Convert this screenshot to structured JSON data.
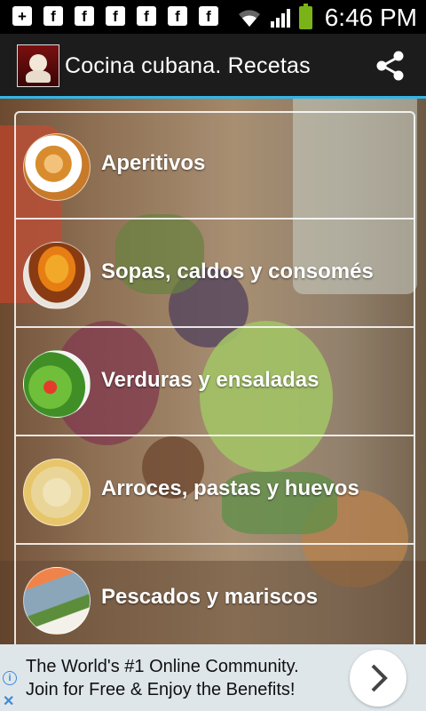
{
  "status_bar": {
    "time": "6:46 PM",
    "notification_icons": [
      "plus-box-icon",
      "facebook-icon",
      "facebook-icon",
      "facebook-icon",
      "facebook-icon",
      "facebook-icon",
      "facebook-icon"
    ],
    "notification_glyphs": [
      "+",
      "f",
      "f",
      "f",
      "f",
      "f",
      "f"
    ]
  },
  "action_bar": {
    "title": "Cocina cubana. Recetas",
    "share_icon": "share-icon",
    "accent": "#33b5e5"
  },
  "categories": [
    {
      "label": "Aperitivos",
      "icon": "appetizer-thumb"
    },
    {
      "label": "Sopas, caldos y consomés",
      "icon": "soup-thumb"
    },
    {
      "label": "Verduras y ensaladas",
      "icon": "salad-thumb"
    },
    {
      "label": "Arroces, pastas y huevos",
      "icon": "rice-thumb"
    },
    {
      "label": "Pescados y mariscos",
      "icon": "fish-thumb"
    }
  ],
  "ad": {
    "line1": "The World's #1 Online Community.",
    "line2": "Join for Free & Enjoy the Benefits!",
    "info_glyph": "i",
    "close_glyph": "✕",
    "go_icon": "chevron-right-icon"
  }
}
